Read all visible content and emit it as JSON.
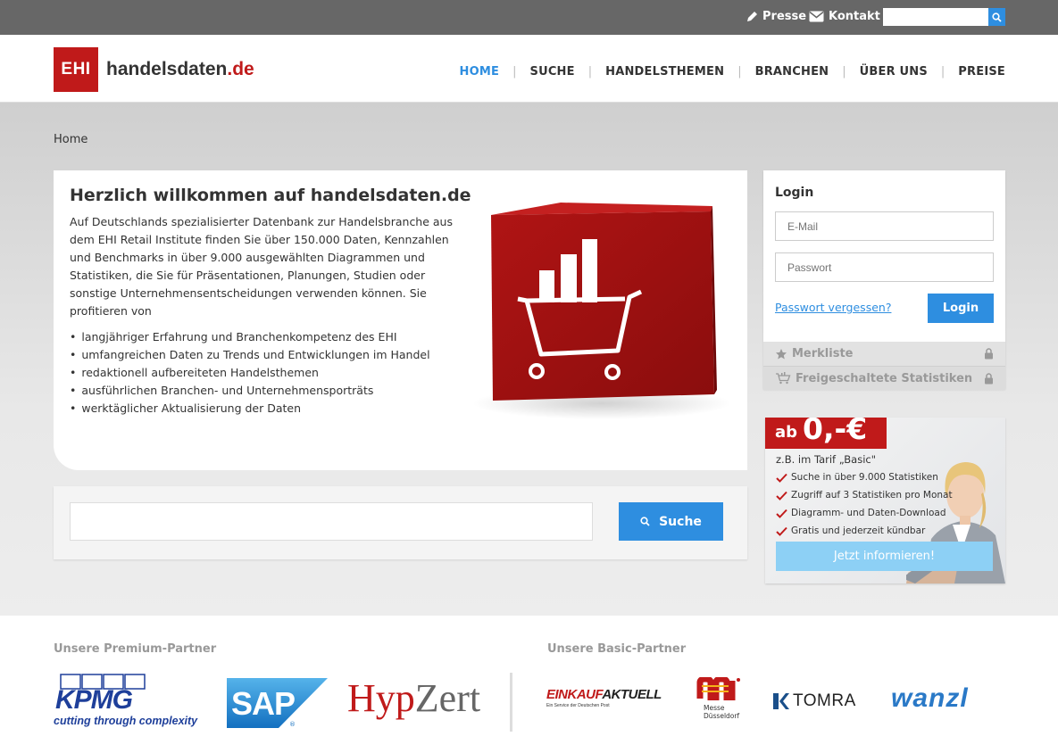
{
  "topbar": {
    "presse": "Presse",
    "kontakt": "Kontakt",
    "search_placeholder": ""
  },
  "header": {
    "logo_badge": "EHI",
    "logo_name": "handelsdaten",
    "logo_tld": ".de",
    "nav": [
      "HOME",
      "SUCHE",
      "HANDELSTHEMEN",
      "BRANCHEN",
      "ÜBER UNS",
      "PREISE"
    ]
  },
  "breadcrumb": "Home",
  "welcome": {
    "title": "Herzlich willkommen auf handelsdaten.de",
    "intro": "Auf Deutschlands spezialisierter Datenbank zur Handelsbranche aus dem EHI Retail Institute finden Sie über 150.000 Daten, Kennzahlen und Benchmarks in über 9.000 ausgewählten Diagrammen und Statistiken, die Sie für Präsentationen, Planungen, Studien oder sonstige Unternehmensentscheidungen verwenden können. Sie profitieren von",
    "bullets": [
      "langjähriger Erfahrung und Branchenkompetenz des EHI",
      "umfangreichen Daten zu Trends und Entwicklungen im Handel",
      "redaktionell aufbereiteten Handelsthemen",
      "ausführlichen Branchen- und Unternehmensporträts",
      "werktäglicher Aktualisierung der Daten"
    ]
  },
  "search": {
    "placeholder": "",
    "button": "Suche"
  },
  "login": {
    "title": "Login",
    "email_placeholder": "E-Mail",
    "password_placeholder": "Passwort",
    "forgot": "Passwort vergessen?",
    "button": "Login",
    "merkliste": "Merkliste",
    "freigeschaltet": "Freigeschaltete Statistiken"
  },
  "promo": {
    "ab": "ab",
    "price": "0,-€",
    "tarif": "z.B. im Tarif „Basic\"",
    "features": [
      "Suche in über 9.000 Statistiken",
      "Zugriff auf 3 Statistiken pro Monat",
      "Diagramm- und Daten-Download",
      "Gratis und jederzeit kündbar"
    ],
    "cta": "Jetzt informieren!"
  },
  "partners": {
    "premium_heading": "Unsere Premium-Partner",
    "basic_heading": "Unsere Basic-Partner",
    "kpmg": "KPMG",
    "kpmg_tagline": "cutting through complexity",
    "sap": "SAP",
    "hypzert_a": "Hyp",
    "hypzert_b": "Zert",
    "einkauf_a": "EINKAUF",
    "einkauf_b": "AKTUELL",
    "einkauf_sub": "Ein Service der Deutschen Post",
    "messe_a": "Messe",
    "messe_b": "Düsseldorf",
    "tomra": "TOMRA",
    "wanzl": "wanzl"
  },
  "colors": {
    "accent": "#2e8ee0",
    "brand_red": "#c01a1a",
    "topbar": "#676767"
  }
}
